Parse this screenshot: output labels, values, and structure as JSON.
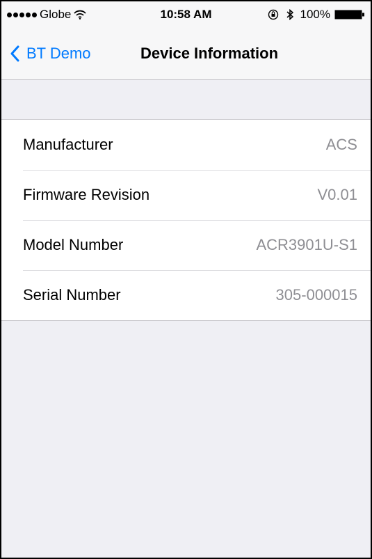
{
  "status_bar": {
    "carrier": "Globe",
    "time": "10:58 AM",
    "battery": "100%"
  },
  "nav": {
    "back_label": "BT Demo",
    "title": "Device Information"
  },
  "device_info": [
    {
      "label": "Manufacturer",
      "value": "ACS"
    },
    {
      "label": "Firmware Revision",
      "value": "V0.01"
    },
    {
      "label": "Model Number",
      "value": "ACR3901U-S1"
    },
    {
      "label": "Serial Number",
      "value": "305-000015"
    }
  ],
  "colors": {
    "accent": "#007aff",
    "background": "#efeff4",
    "value_text": "#8e8e93"
  }
}
